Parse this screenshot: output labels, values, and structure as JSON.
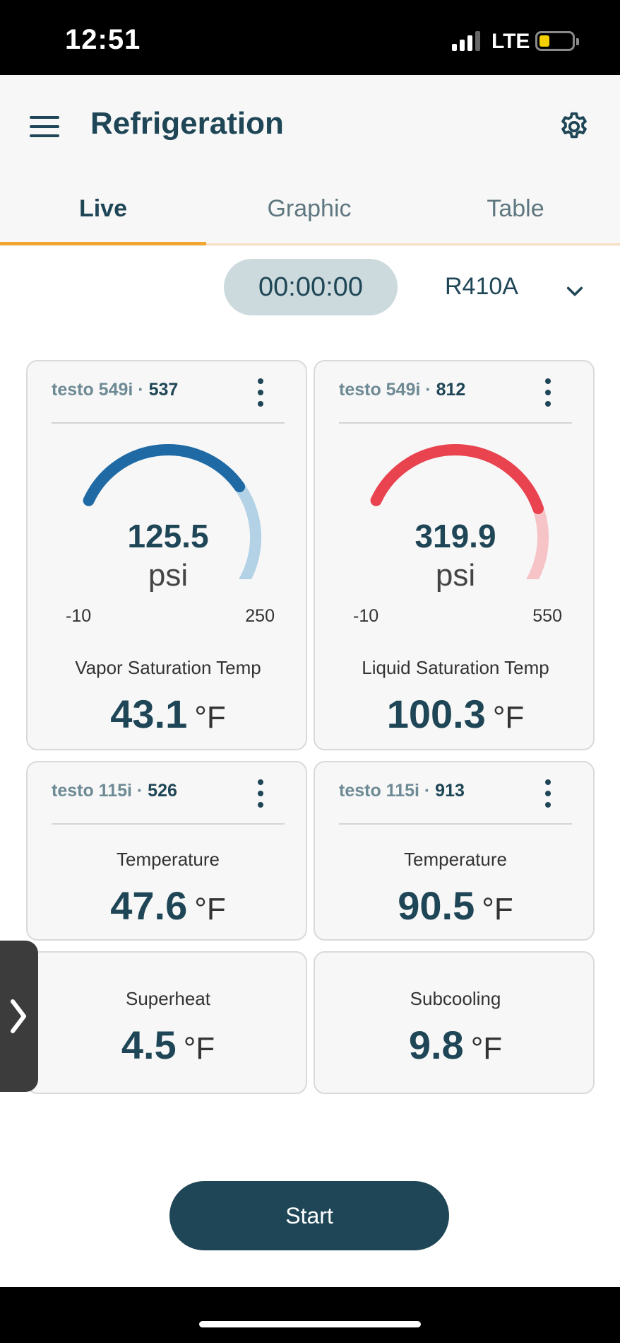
{
  "status_bar": {
    "time": "12:51",
    "network": "LTE",
    "battery_icon": "battery-low-icon",
    "signal_icon": "cellular-signal-icon"
  },
  "header": {
    "title": "Refrigeration",
    "menu_icon": "hamburger-menu-icon",
    "settings_icon": "gear-icon"
  },
  "tabs": [
    {
      "label": "Live",
      "active": true
    },
    {
      "label": "Graphic",
      "active": false
    },
    {
      "label": "Table",
      "active": false
    }
  ],
  "controls": {
    "timer": "00:00:00",
    "refrigerant": "R410A"
  },
  "cards": {
    "vapor": {
      "model": "testo 549i",
      "serial": "537",
      "gauge_value": "125.5",
      "gauge_unit": "psi",
      "gauge_min": "-10",
      "gauge_max": "250",
      "gauge_fraction": 0.52,
      "gauge_color": "#1f6aa5",
      "gauge_track_color": "#b3d2e6",
      "label": "Vapor Saturation Temp",
      "value": "43.1",
      "unit": "°F"
    },
    "liquid": {
      "model": "testo 549i",
      "serial": "812",
      "gauge_value": "319.9",
      "gauge_unit": "psi",
      "gauge_min": "-10",
      "gauge_max": "550",
      "gauge_fraction": 0.59,
      "gauge_color": "#e8434f",
      "gauge_track_color": "#f6c3c7",
      "label": "Liquid Saturation Temp",
      "value": "100.3",
      "unit": "°F"
    },
    "temp_526": {
      "model": "testo 115i",
      "serial": "526",
      "label": "Temperature",
      "value": "47.6",
      "unit": "°F"
    },
    "temp_913": {
      "model": "testo 115i",
      "serial": "913",
      "label": "Temperature",
      "value": "90.5",
      "unit": "°F"
    },
    "superheat": {
      "label": "Superheat",
      "value": "4.5",
      "unit": "°F"
    },
    "subcooling": {
      "label": "Subcooling",
      "value": "9.8",
      "unit": "°F"
    }
  },
  "actions": {
    "start_label": "Start"
  }
}
